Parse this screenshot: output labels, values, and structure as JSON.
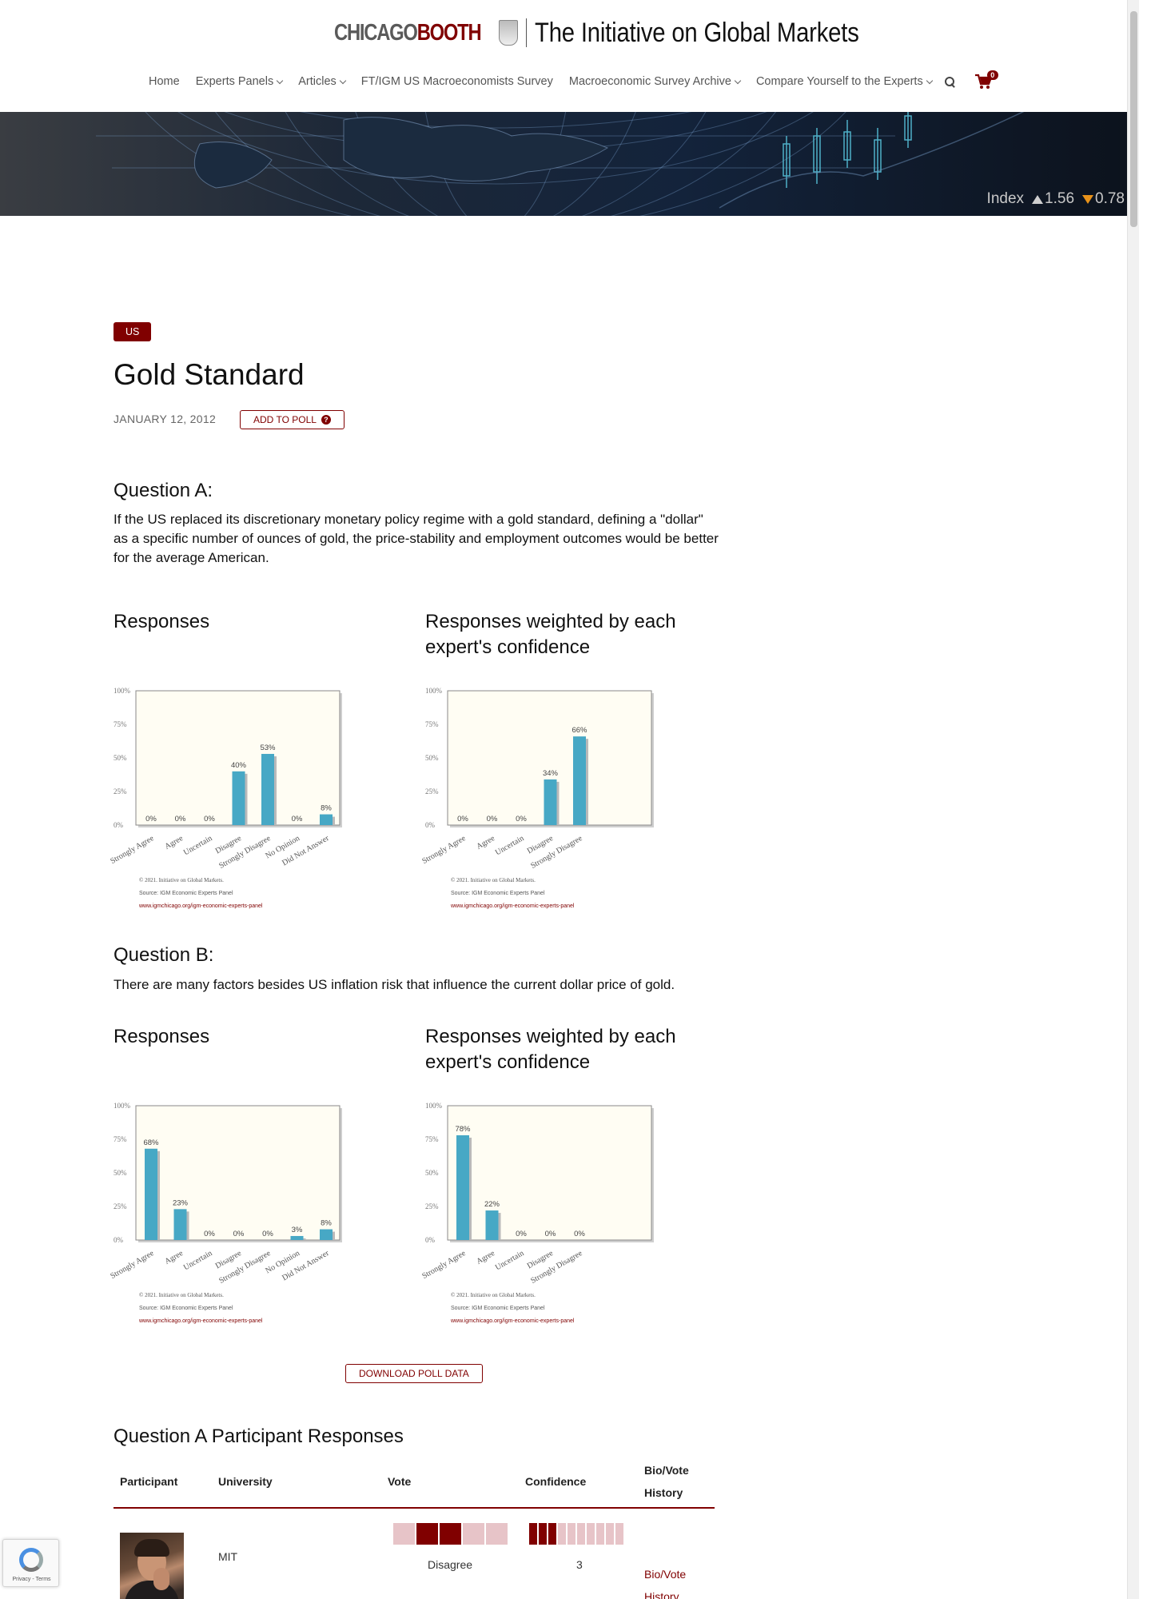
{
  "header": {
    "brand": {
      "chicago": "CHICAGO",
      "booth": "BOOTH",
      "title": "The Initiative on Global Markets"
    },
    "nav": [
      {
        "label": "Home",
        "has_dropdown": false
      },
      {
        "label": "Experts Panels",
        "has_dropdown": true
      },
      {
        "label": "Articles",
        "has_dropdown": true
      },
      {
        "label": "FT/IGM US Macroeconomists Survey",
        "has_dropdown": false
      },
      {
        "label": "Macroeconomic Survey Archive",
        "has_dropdown": true
      },
      {
        "label": "Compare Yourself to the Experts",
        "has_dropdown": true
      }
    ],
    "search_icon": "search-icon",
    "cart_icon": "shopping-cart-icon",
    "cart_count": "0"
  },
  "banner": {
    "ticker_label": "Index",
    "up_value": "1.56",
    "down_value": "0.78",
    "up_color": "#cfcfcf",
    "down_color": "#e8921a"
  },
  "poll": {
    "tag": "US",
    "title": "Gold Standard",
    "date": "JANUARY 12, 2012",
    "add_to_poll": "ADD TO POLL",
    "download": "DOWNLOAD POLL DATA"
  },
  "questions": [
    {
      "heading": "Question A:",
      "text": "If the US replaced its discretionary monetary policy regime with a gold standard, defining a \"dollar\" as a specific number of ounces of gold, the price-stability and employment outcomes would be better for the average American.",
      "responses_heading": "Responses",
      "weighted_heading": "Responses weighted by each expert's confidence"
    },
    {
      "heading": "Question B:",
      "text": "There are many factors besides US inflation risk that influence the current dollar price of gold.",
      "responses_heading": "Responses",
      "weighted_heading": "Responses weighted by each expert's confidence"
    }
  ],
  "chart_footer": {
    "copyright": "© 2021. Initiative on Global Markets.",
    "source": "Source: IGM Economic Experts Panel",
    "url": "www.igmchicago.org/igm-economic-experts-panel"
  },
  "chart_data": [
    {
      "type": "bar",
      "categories": [
        "Strongly Agree",
        "Agree",
        "Uncertain",
        "Disagree",
        "Strongly Disagree",
        "No Opinion",
        "Did Not Answer"
      ],
      "values": [
        0,
        0,
        0,
        40,
        53,
        0,
        8
      ],
      "data_labels": [
        "0%",
        "0%",
        "0%",
        "40%",
        "53%",
        "0%",
        "8%"
      ],
      "yticks": [
        "0%",
        "25%",
        "50%",
        "75%",
        "100%"
      ],
      "ylim": [
        0,
        100
      ],
      "bar_color": "#47a8c5",
      "plot_bg": "#fffdf3"
    },
    {
      "type": "bar",
      "categories": [
        "Strongly Agree",
        "Agree",
        "Uncertain",
        "Disagree",
        "Strongly Disagree"
      ],
      "values": [
        0,
        0,
        0,
        34,
        66
      ],
      "data_labels": [
        "0%",
        "0%",
        "0%",
        "34%",
        "66%"
      ],
      "yticks": [
        "0%",
        "25%",
        "50%",
        "75%",
        "100%"
      ],
      "ylim": [
        0,
        100
      ],
      "bar_color": "#47a8c5",
      "plot_bg": "#fffdf3"
    },
    {
      "type": "bar",
      "categories": [
        "Strongly Agree",
        "Agree",
        "Uncertain",
        "Disagree",
        "Strongly Disagree",
        "No Opinion",
        "Did Not Answer"
      ],
      "values": [
        68,
        23,
        0,
        0,
        0,
        3,
        8
      ],
      "data_labels": [
        "68%",
        "23%",
        "0%",
        "0%",
        "0%",
        "3%",
        "8%"
      ],
      "yticks": [
        "0%",
        "25%",
        "50%",
        "75%",
        "100%"
      ],
      "ylim": [
        0,
        100
      ],
      "bar_color": "#47a8c5",
      "plot_bg": "#fffdf3"
    },
    {
      "type": "bar",
      "categories": [
        "Strongly Agree",
        "Agree",
        "Uncertain",
        "Disagree",
        "Strongly Disagree"
      ],
      "values": [
        78,
        22,
        0,
        0,
        0
      ],
      "data_labels": [
        "78%",
        "22%",
        "0%",
        "0%",
        "0%"
      ],
      "yticks": [
        "0%",
        "25%",
        "50%",
        "75%",
        "100%"
      ],
      "ylim": [
        0,
        100
      ],
      "bar_color": "#47a8c5",
      "plot_bg": "#fffdf3"
    }
  ],
  "participants": {
    "heading": "Question A Participant Responses",
    "columns": [
      "Participant",
      "University",
      "Vote",
      "Confidence",
      "Bio/Vote History"
    ],
    "rows": [
      {
        "university": "MIT",
        "vote": "Disagree",
        "vote_scale": 5,
        "vote_selected": 3,
        "confidence": "3",
        "confidence_scale": 10,
        "bio_link": "Bio/Vote History"
      }
    ]
  },
  "recaptcha": {
    "text": "Privacy - Terms"
  }
}
